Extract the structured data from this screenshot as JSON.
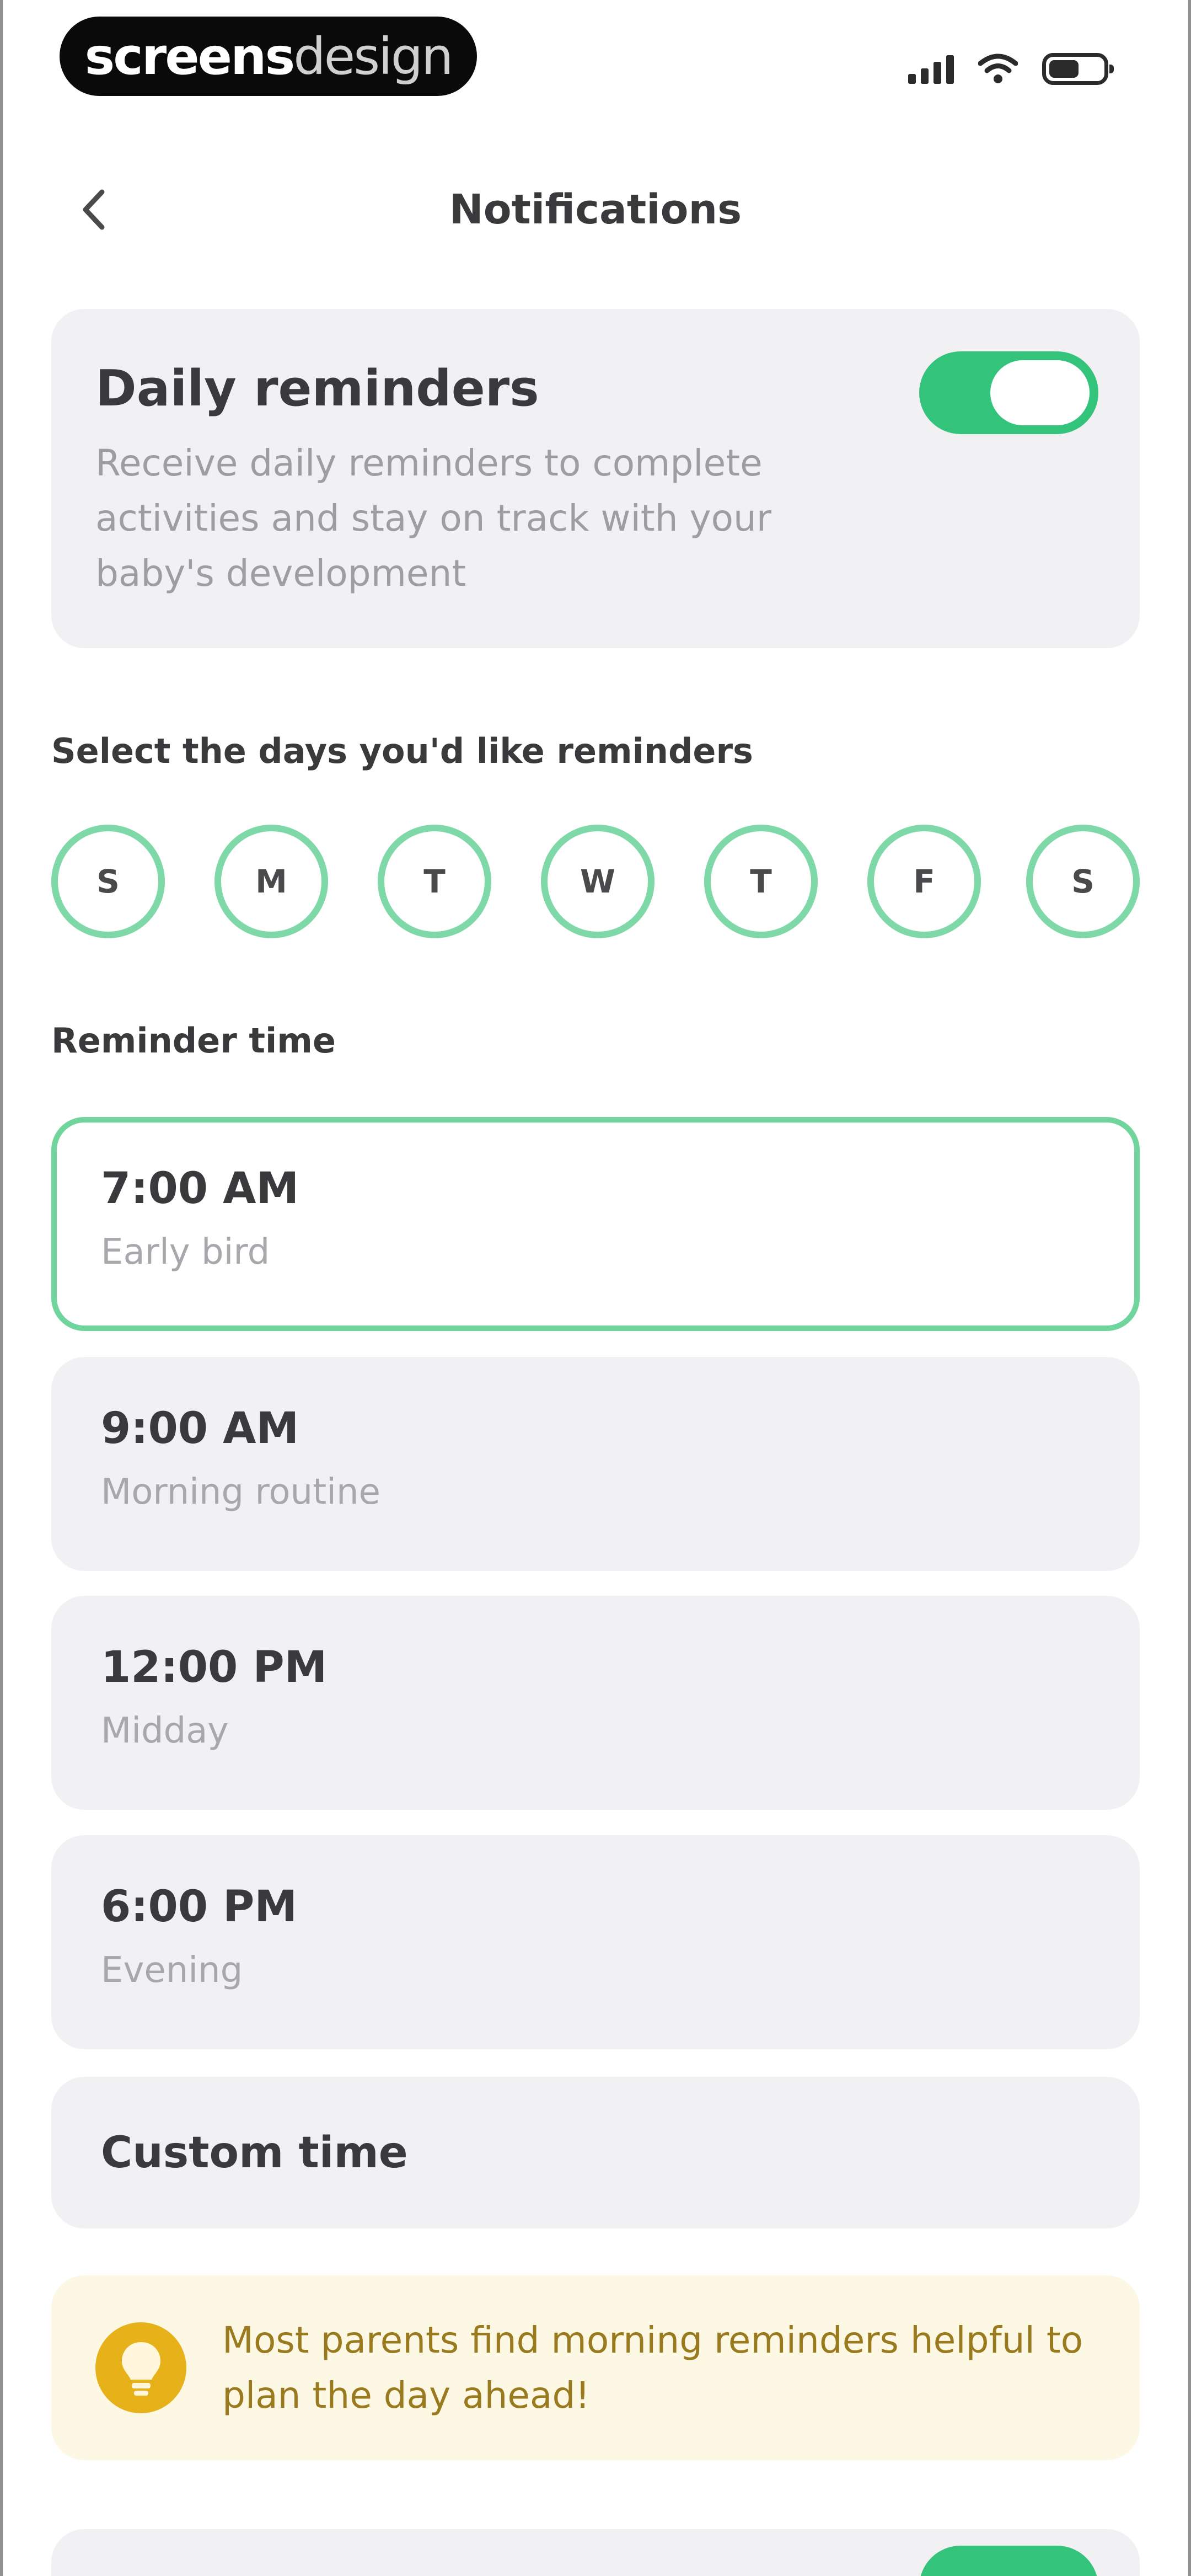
{
  "status_bar": {
    "brand_bold": "screens",
    "brand_light": "design"
  },
  "header": {
    "title": "Notifications"
  },
  "daily_reminders": {
    "title": "Daily reminders",
    "description": "Receive daily reminders to complete activities and stay on track with your baby's development",
    "enabled": true
  },
  "days": {
    "label": "Select the days you'd like reminders",
    "items": [
      "S",
      "M",
      "T",
      "W",
      "T",
      "F",
      "S"
    ]
  },
  "reminder_time": {
    "label": "Reminder time",
    "options": [
      {
        "time": "7:00 AM",
        "caption": "Early bird",
        "selected": true
      },
      {
        "time": "9:00 AM",
        "caption": "Morning routine",
        "selected": false
      },
      {
        "time": "12:00 PM",
        "caption": "Midday",
        "selected": false
      },
      {
        "time": "6:00 PM",
        "caption": "Evening",
        "selected": false
      }
    ],
    "custom_label": "Custom time"
  },
  "tip": {
    "text": "Most parents find morning reminders helpful to plan the day ahead!"
  },
  "colors": {
    "accent_green": "#34c37a",
    "selected_outline": "#6fd59c",
    "tip_background": "#fdf8e3",
    "tip_icon": "#e7b11a",
    "tip_text": "#9a7a1e"
  },
  "icons": {
    "back": "chevron-left-icon",
    "signal": "cellular-signal-icon",
    "wifi": "wifi-icon",
    "battery": "battery-icon",
    "tip": "lightbulb-icon"
  }
}
